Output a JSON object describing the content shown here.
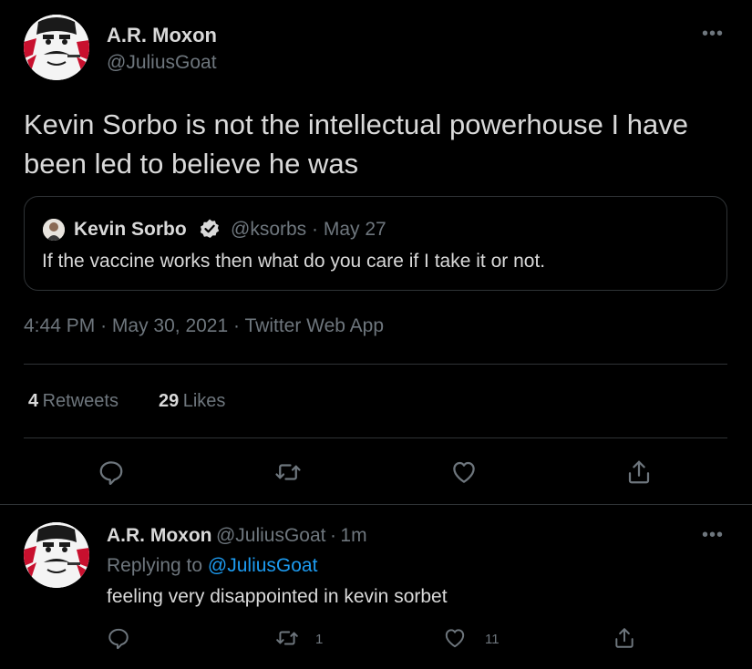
{
  "tweet": {
    "author_name": "A.R. Moxon",
    "author_handle": "@JuliusGoat",
    "more_glyph": "•••",
    "text": "Kevin Sorbo is not the intellectual powerhouse I have been led to believe he was",
    "quoted": {
      "name": "Kevin Sorbo",
      "handle": "@ksorbs",
      "separator": "·",
      "date": "May 27",
      "text": "If the vaccine works then what do you care if I take it or not."
    },
    "time": "4:44 PM",
    "date": "May 30, 2021",
    "client": "Twitter Web App",
    "separator": "·",
    "stats": {
      "retweets_count": "4",
      "retweets_label": "Retweets",
      "likes_count": "29",
      "likes_label": "Likes"
    },
    "actions": [
      "reply-icon",
      "retweet-icon",
      "like-icon",
      "share-icon"
    ]
  },
  "reply": {
    "author_name": "A.R. Moxon",
    "author_handle": "@JuliusGoat",
    "separator": "·",
    "time": "1m",
    "replying_to_label": "Replying to",
    "replying_to_handle": "@JuliusGoat",
    "text": "feeling very disappointed in kevin sorbet",
    "retweet_count": "1",
    "like_count": "11",
    "more_glyph": "•••"
  },
  "colors": {
    "background": "#000000",
    "text": "#d9d9d9",
    "secondary": "#6e767d",
    "border": "#2f3336",
    "link": "#1d9bf0",
    "avatar_red": "#c8102e"
  }
}
